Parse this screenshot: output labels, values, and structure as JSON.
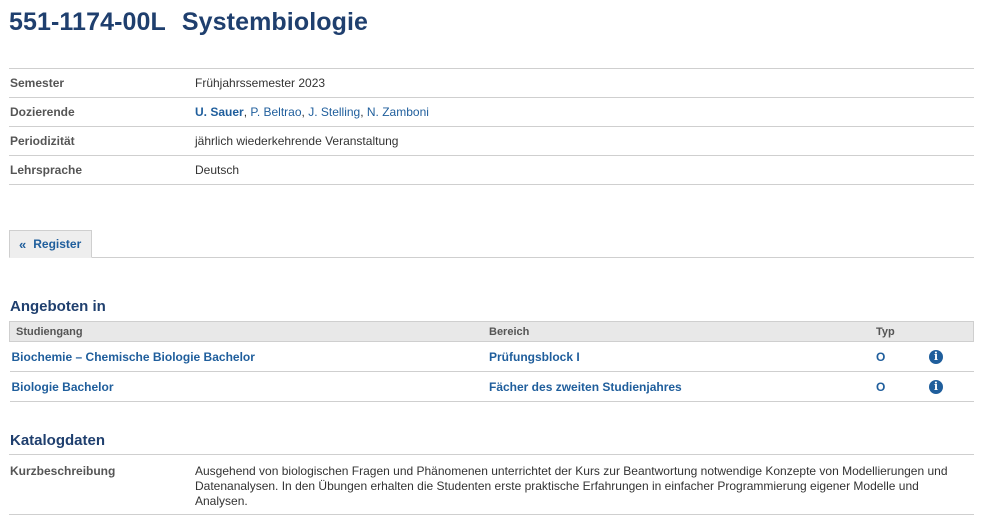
{
  "course": {
    "number": "551-1174-00L",
    "title": "Systembiologie"
  },
  "info": {
    "semester_label": "Semester",
    "semester_value": "Frühjahrssemester 2023",
    "lecturers_label": "Dozierende",
    "lecturers": [
      "U. Sauer",
      "P. Beltrao",
      "J. Stelling",
      "N. Zamboni"
    ],
    "lecturer_separator": ", ",
    "periodicity_label": "Periodizität",
    "periodicity_value": "jährlich wiederkehrende Veranstaltung",
    "language_label": "Lehrsprache",
    "language_value": "Deutsch"
  },
  "tab": {
    "chevron": "«",
    "label": "Register"
  },
  "offered": {
    "section_title": "Angeboten in",
    "headers": {
      "program": "Studiengang",
      "area": "Bereich",
      "type": "Typ"
    },
    "rows": [
      {
        "program": "Biochemie – Chemische Biologie Bachelor",
        "area": "Prüfungsblock I",
        "type": "O",
        "info_icon": "i"
      },
      {
        "program": "Biologie Bachelor",
        "area": "Fächer des zweiten Studienjahres",
        "type": "O",
        "info_icon": "i"
      }
    ]
  },
  "catalog": {
    "section_title": "Katalogdaten",
    "summary_label": "Kurzbeschreibung",
    "summary_text": "Ausgehend von biologischen Fragen und Phänomenen unterrichtet der Kurs zur Beantwortung notwendige Konzepte von Modellierungen und Datenanalysen. In den Übungen erhalten die Studenten erste praktische Erfahrungen in einfacher Programmierung eigener Modelle und Analysen."
  },
  "colors": {
    "title": "#1f3f6e",
    "link": "#1f5e9c",
    "border": "#cfcfcf",
    "header_bg": "#e8e8e8"
  },
  "icons": {
    "tab_chevron": "double-chevron-left-icon",
    "row_info": "info-circle-icon"
  }
}
